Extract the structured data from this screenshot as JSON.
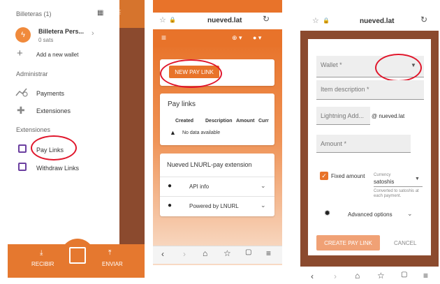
{
  "panel1": {
    "header": "Billeteras (1)",
    "wallet_name": "Billetera Pers...",
    "wallet_balance": "0 sats",
    "add_wallet": "Add a new wallet",
    "section_admin": "Administrar",
    "payments": "Payments",
    "extensions_link": "Extensiones",
    "section_extensions": "Extensiones",
    "pay_links": "Pay Links",
    "withdraw_links": "Withdraw Links",
    "receive": "RECIBIR",
    "send": "ENVIAR",
    "accent_color": "#e5782f"
  },
  "panel2": {
    "url": "nueved.lat",
    "new_pay_link": "NEW PAY LINK",
    "pay_links_title": "Pay links",
    "columns": [
      "Created",
      "Description",
      "Amount",
      "Curr"
    ],
    "no_data": "No data available",
    "extension_title": "Nueved LNURL-pay extension",
    "api_info": "API info",
    "powered_by": "Powered by LNURL"
  },
  "panel3": {
    "url": "nueved.lat",
    "wallet_placeholder": "Wallet *",
    "item_description": "Item description *",
    "lightning_address": "Lightning Add...",
    "domain_suffix": "@ nueved.lat",
    "amount": "Amount *",
    "fixed_amount": "Fixed amount",
    "currency_label": "Currency",
    "currency_value": "satoshis",
    "converted_note": "Converted to satoshis at each payment.",
    "advanced_options": "Advanced options",
    "create_button": "CREATE PAY LINK",
    "cancel_button": "CANCEL"
  }
}
